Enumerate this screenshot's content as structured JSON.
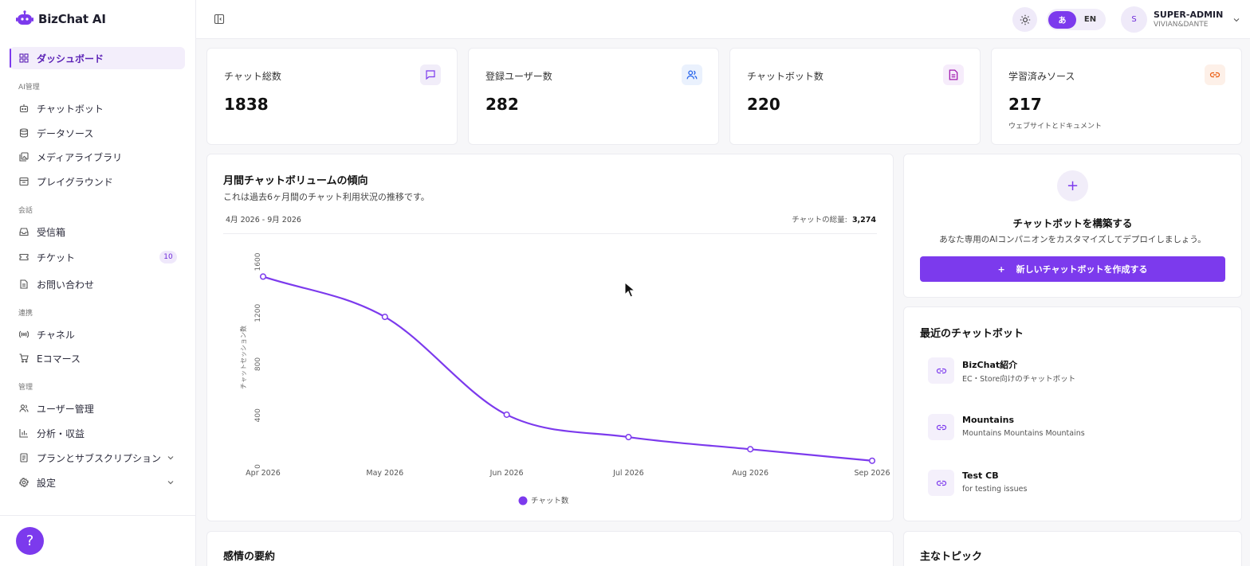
{
  "brand": {
    "name": "BizChat AI"
  },
  "sidebar": {
    "items": [
      {
        "label": "ダッシュボード",
        "icon": "dashboard-icon",
        "active": true
      },
      {
        "section": "AI管理"
      },
      {
        "label": "チャットボット",
        "icon": "bot-icon"
      },
      {
        "label": "データソース",
        "icon": "database-icon"
      },
      {
        "label": "メディアライブラリ",
        "icon": "media-icon"
      },
      {
        "label": "プレイグラウンド",
        "icon": "playground-icon"
      },
      {
        "section": "会話"
      },
      {
        "label": "受信箱",
        "icon": "inbox-icon"
      },
      {
        "label": "チケット",
        "icon": "ticket-icon",
        "badge": "10"
      },
      {
        "label": "お問い合わせ",
        "icon": "document-icon"
      },
      {
        "section": "連携"
      },
      {
        "label": "チャネル",
        "icon": "broadcast-icon"
      },
      {
        "label": "Eコマース",
        "icon": "cart-icon"
      },
      {
        "section": "管理"
      },
      {
        "label": "ユーザー管理",
        "icon": "users-icon"
      },
      {
        "label": "分析・収益",
        "icon": "bar-chart-icon"
      },
      {
        "label": "プランとサブスクリプション",
        "icon": "plan-icon",
        "expandable": true
      },
      {
        "label": "設定",
        "icon": "gear-icon",
        "expandable": true
      }
    ],
    "help_label": "?"
  },
  "header": {
    "lang_ja": "あ",
    "lang_en": "EN",
    "user_initial": "S",
    "user_name": "SUPER-ADMIN",
    "user_org": "VIVIAN&DANTE"
  },
  "stats": [
    {
      "label": "チャット総数",
      "value": "1838",
      "icon": "chat-icon",
      "color": "#7c3aed",
      "bg": "#f1edf9"
    },
    {
      "label": "登録ユーザー数",
      "value": "282",
      "icon": "users-icon",
      "color": "#2563eb",
      "bg": "#eaf1fd"
    },
    {
      "label": "チャットボット数",
      "value": "220",
      "icon": "document-icon",
      "color": "#a21caf",
      "bg": "#f6ecfb"
    },
    {
      "label": "学習済みソース",
      "value": "217",
      "sub": "ウェブサイトとドキュメント",
      "icon": "link-icon",
      "color": "#ea580c",
      "bg": "#fdf0e8"
    }
  ],
  "chart": {
    "title": "月間チャットボリュームの傾向",
    "subtitle": "これは過去6ヶ月間のチャット利用状況の推移です。",
    "range": "4月 2026 - 9月 2026",
    "total_label": "チャットの総量:",
    "total_value": "3,274"
  },
  "chart_data": {
    "type": "line",
    "x": [
      "Apr 2026",
      "May 2026",
      "Jun 2026",
      "Jul 2026",
      "Aug 2026",
      "Sep 2026"
    ],
    "series": [
      {
        "name": "チャット数",
        "values": [
          1485,
          1170,
          405,
          230,
          135,
          45
        ],
        "color": "#7c3aed"
      }
    ],
    "ylabel": "チャットセッション数",
    "yticks": [
      "0",
      "400",
      "800",
      "1200",
      "1600"
    ],
    "ylim": [
      0,
      1600
    ],
    "grid": false,
    "legend": "bottom-center"
  },
  "cta": {
    "plus": "+",
    "title": "チャットボットを構築する",
    "description": "あなた専用のAIコンパニオンをカスタマイズしてデプロイしましょう。",
    "button_label": "新しいチャットボットを作成する",
    "button_plus": "+"
  },
  "recent": {
    "title": "最近のチャットボット",
    "items": [
      {
        "name": "BizChat紹介",
        "desc": "EC・Store向けのチャットボット"
      },
      {
        "name": "Mountains",
        "desc": "Mountains Mountains Mountains"
      },
      {
        "name": "Test CB",
        "desc": "for testing issues"
      }
    ]
  },
  "sections": {
    "sentiment_title": "感情の要約",
    "topics_title": "主なトピック"
  }
}
